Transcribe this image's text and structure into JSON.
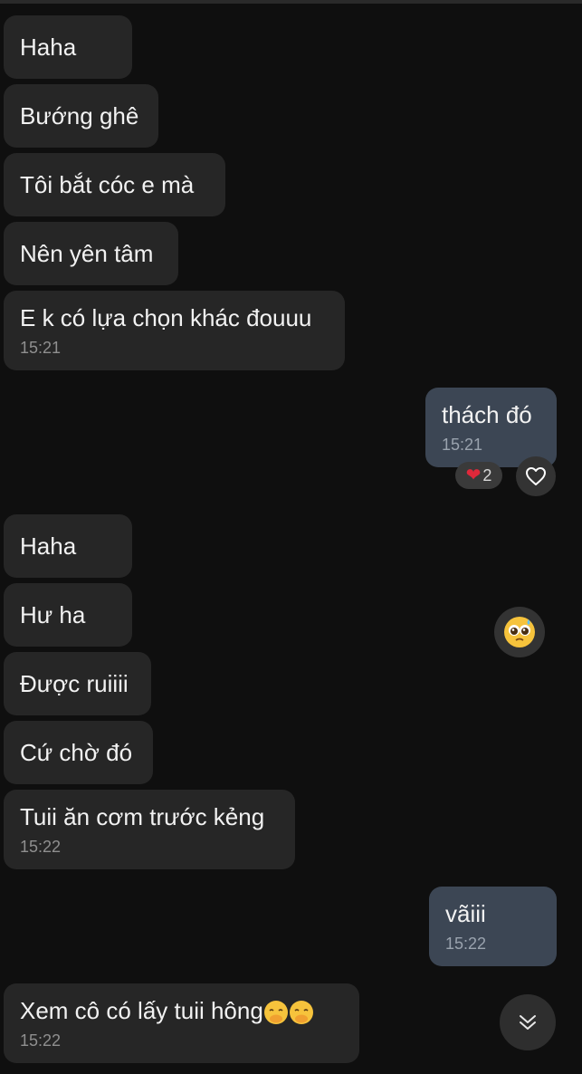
{
  "messages": [
    {
      "text": "Haha",
      "time": ""
    },
    {
      "text": "Bướng ghê",
      "time": ""
    },
    {
      "text": "Tôi bắt cóc e mà",
      "time": ""
    },
    {
      "text": "Nên yên tâm",
      "time": ""
    },
    {
      "text": "E k có lựa chọn khác đouuu",
      "time": "15:21"
    },
    {
      "text": "thách đó",
      "time": "15:21"
    },
    {
      "text": "Haha",
      "time": ""
    },
    {
      "text": "Hư ha",
      "time": ""
    },
    {
      "text": "Được ruiiii",
      "time": ""
    },
    {
      "text": "Cứ chờ đó",
      "time": ""
    },
    {
      "text": "Tuii ăn cơm trước kẻng",
      "time": "15:22"
    },
    {
      "text": "vãiii",
      "time": "15:22"
    },
    {
      "text": "Xem cô có lấy tuii hông",
      "time": "15:22"
    }
  ],
  "reaction": {
    "icon": "heart-icon",
    "count": "2"
  },
  "colors": {
    "incoming": "#262626",
    "outgoing": "#3c4654",
    "background": "#0f0f0f"
  }
}
